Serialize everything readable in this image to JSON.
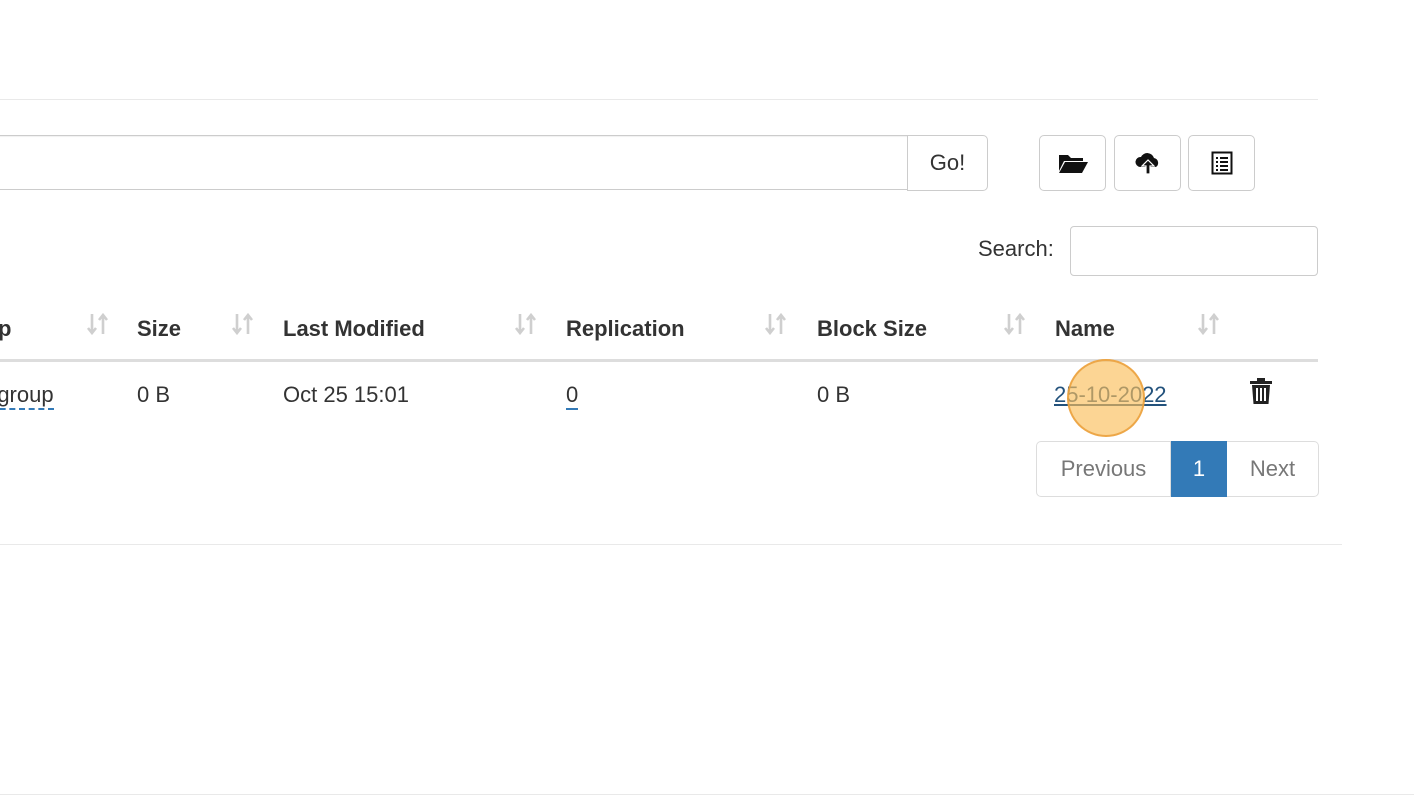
{
  "path_bar": {
    "value": "",
    "go_label": "Go!"
  },
  "toolbar": {
    "buttons": [
      {
        "icon": "folder-open-icon"
      },
      {
        "icon": "cloud-upload-icon"
      },
      {
        "icon": "list-icon"
      }
    ]
  },
  "search": {
    "label": "Search:",
    "value": ""
  },
  "table": {
    "columns": [
      "p",
      "Size",
      "Last Modified",
      "Replication",
      "Block Size",
      "Name"
    ],
    "rows": [
      {
        "group": "rgroup",
        "size": "0 B",
        "last_modified": "Oct 25 15:01",
        "replication": "0",
        "block_size": "0 B",
        "name": "25-10-2022",
        "delete_icon": "trash-icon"
      }
    ]
  },
  "pagination": {
    "previous": "Previous",
    "current": "1",
    "next": "Next"
  },
  "colors": {
    "accent": "#337ab7",
    "cursor_highlight": "#f7c16b"
  }
}
